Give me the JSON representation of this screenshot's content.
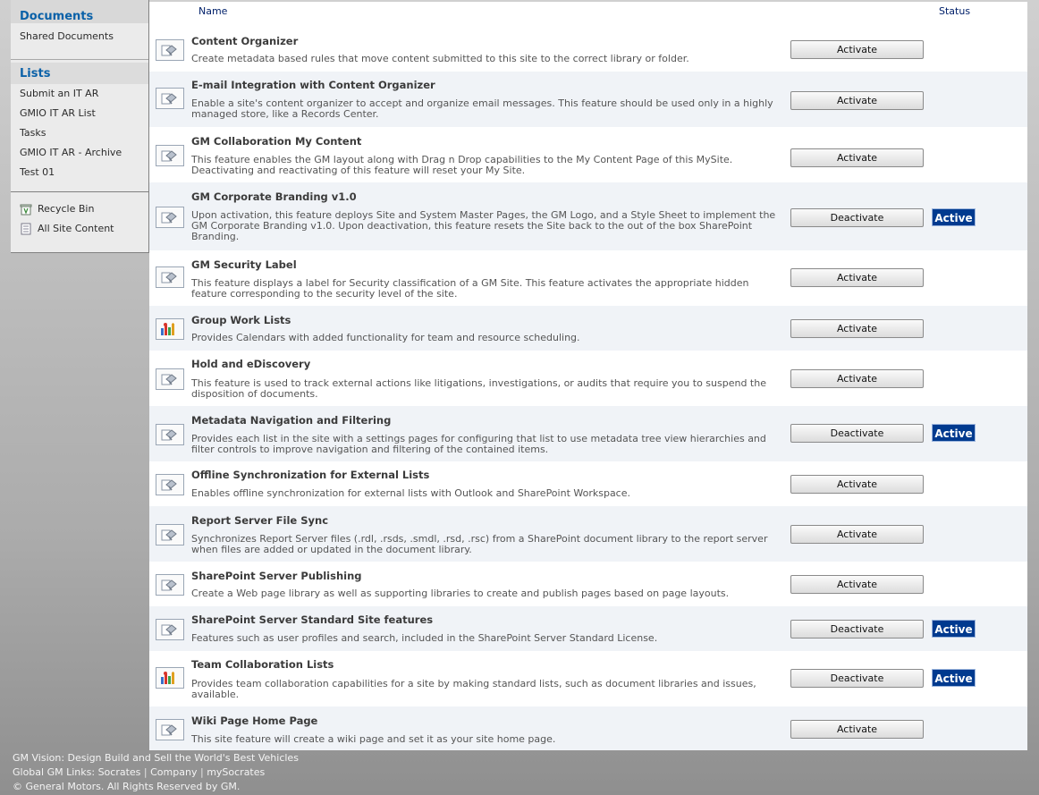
{
  "nav": {
    "documents_header": "Documents",
    "documents": [
      "Shared Documents"
    ],
    "lists_header": "Lists",
    "lists": [
      "Submit an IT AR",
      "GMIO IT AR List",
      "Tasks",
      "GMIO IT AR - Archive",
      "Test 01"
    ],
    "recycle_bin": "Recycle Bin",
    "all_site_content": "All Site Content"
  },
  "table": {
    "col_name": "Name",
    "col_status": "Status"
  },
  "features": [
    {
      "title": "Content Organizer",
      "desc": "Create metadata based rules that move content submitted to this site to the correct library or folder.",
      "button": "Activate",
      "status": "",
      "icon": "generic-feature-icon"
    },
    {
      "title": "E-mail Integration with Content Organizer",
      "desc": "Enable a site's content organizer to accept and organize email messages. This feature should be used only in a highly managed store, like a Records Center.",
      "button": "Activate",
      "status": "",
      "icon": "generic-feature-icon"
    },
    {
      "title": "GM Collaboration My Content",
      "desc": "This feature enables the GM layout along with Drag n Drop capabilities to the My Content Page of this MySite. Deactivating and reactivating of this feature will reset your My Site.",
      "button": "Activate",
      "status": "",
      "icon": "generic-feature-icon"
    },
    {
      "title": "GM Corporate Branding v1.0",
      "desc": "Upon activation, this feature deploys Site and System Master Pages, the GM Logo, and a Style Sheet to implement the GM Corporate Branding v1.0. Upon deactivation, this feature resets the Site back to the out of the box SharePoint Branding.",
      "button": "Deactivate",
      "status": "Active",
      "icon": "generic-feature-icon"
    },
    {
      "title": "GM Security Label",
      "desc": "This feature displays a label for Security classification of a GM Site. This feature activates the appropriate hidden feature corresponding to the security level of the site.",
      "button": "Activate",
      "status": "",
      "icon": "generic-feature-icon"
    },
    {
      "title": "Group Work Lists",
      "desc": "Provides Calendars with added functionality for team and resource scheduling.",
      "button": "Activate",
      "status": "",
      "icon": "team-lists-icon"
    },
    {
      "title": "Hold and eDiscovery",
      "desc": "This feature is used to track external actions like litigations, investigations, or audits that require you to suspend the disposition of documents.",
      "button": "Activate",
      "status": "",
      "icon": "generic-feature-icon"
    },
    {
      "title": "Metadata Navigation and Filtering",
      "desc": "Provides each list in the site with a settings pages for configuring that list to use metadata tree view hierarchies and filter controls to improve navigation and filtering of the contained items.",
      "button": "Deactivate",
      "status": "Active",
      "icon": "generic-feature-icon"
    },
    {
      "title": "Offline Synchronization for External Lists",
      "desc": "Enables offline synchronization for external lists with Outlook and SharePoint Workspace.",
      "button": "Activate",
      "status": "",
      "icon": "generic-feature-icon"
    },
    {
      "title": "Report Server File Sync",
      "desc": "Synchronizes Report Server files (.rdl, .rsds, .smdl, .rsd, .rsc) from a SharePoint document library to the report server when files are added or updated in the document library.",
      "button": "Activate",
      "status": "",
      "icon": "generic-feature-icon"
    },
    {
      "title": "SharePoint Server Publishing",
      "desc": "Create a Web page library as well as supporting libraries to create and publish pages based on page layouts.",
      "button": "Activate",
      "status": "",
      "icon": "generic-feature-icon"
    },
    {
      "title": "SharePoint Server Standard Site features",
      "desc": "Features such as user profiles and search, included in the SharePoint Server Standard License.",
      "button": "Deactivate",
      "status": "Active",
      "icon": "generic-feature-icon"
    },
    {
      "title": "Team Collaboration Lists",
      "desc": "Provides team collaboration capabilities for a site by making standard lists, such as document libraries and issues, available.",
      "button": "Deactivate",
      "status": "Active",
      "icon": "team-lists-icon"
    },
    {
      "title": "Wiki Page Home Page",
      "desc": "This site feature will create a wiki page and set it as your site home page.",
      "button": "Activate",
      "status": "",
      "icon": "generic-feature-icon"
    }
  ],
  "footer": {
    "vision": "GM Vision: Design Build and Sell the World's Best Vehicles",
    "links_label": "Global GM Links:",
    "links": [
      "Socrates",
      "Company",
      "mySocrates"
    ],
    "separator": "|",
    "copyright": "© General Motors. All Rights Reserved by GM."
  }
}
